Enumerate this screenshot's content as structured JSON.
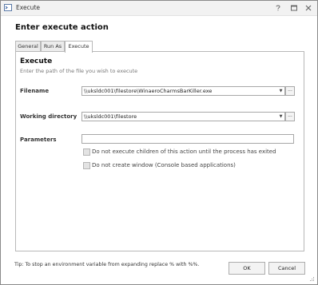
{
  "window": {
    "title": "Execute"
  },
  "dialog": {
    "heading": "Enter execute action"
  },
  "tabs": [
    {
      "label": "General"
    },
    {
      "label": "Run As"
    },
    {
      "label": "Execute"
    }
  ],
  "section": {
    "title": "Execute",
    "subtitle": "Enter the path of the file you wish to execute"
  },
  "fields": {
    "filename": {
      "label": "Filename",
      "value": "\\\\uksldc001\\filestore\\WinaeroCharmsBarKiller.exe"
    },
    "working_directory": {
      "label": "Working directory",
      "value": "\\\\uksldc001\\filestore"
    },
    "parameters": {
      "label": "Parameters",
      "value": ""
    }
  },
  "checkboxes": [
    {
      "label": "Do not execute children of this action until the process has exited",
      "checked": false
    },
    {
      "label": "Do not create window (Console based applications)",
      "checked": false
    }
  ],
  "browse_label": "...",
  "footer": {
    "tip": "Tip: To stop an environment variable from expanding replace % with %%.",
    "ok_label": "OK",
    "cancel_label": "Cancel"
  },
  "colors": {
    "border": "#b8b8b8",
    "tab_inactive": "#ececec",
    "checkbox_fill": "#e3e3e3"
  }
}
